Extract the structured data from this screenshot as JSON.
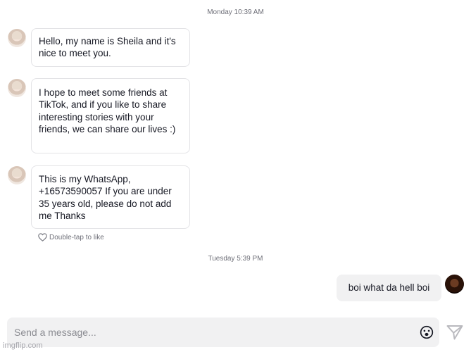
{
  "conversation": {
    "timestamps": [
      "Monday 10:39 AM",
      "Tuesday 5:39 PM"
    ],
    "incoming": [
      "Hello, my name is Sheila and it's nice to meet you.",
      "I hope to meet some friends at TikTok, and if you like to share interesting stories with your friends, we can share our lives :)",
      "This is my WhatsApp, +16573590057 If you are under 35 years old, please do not add me Thanks"
    ],
    "like_hint": "Double-tap to like",
    "outgoing": [
      "boi what da hell boi"
    ]
  },
  "composer": {
    "placeholder": "Send a message..."
  },
  "icons": {
    "like": "heart-outline-icon",
    "emoji": "emoji-icon",
    "send": "send-icon"
  },
  "watermark": "imgflip.com"
}
